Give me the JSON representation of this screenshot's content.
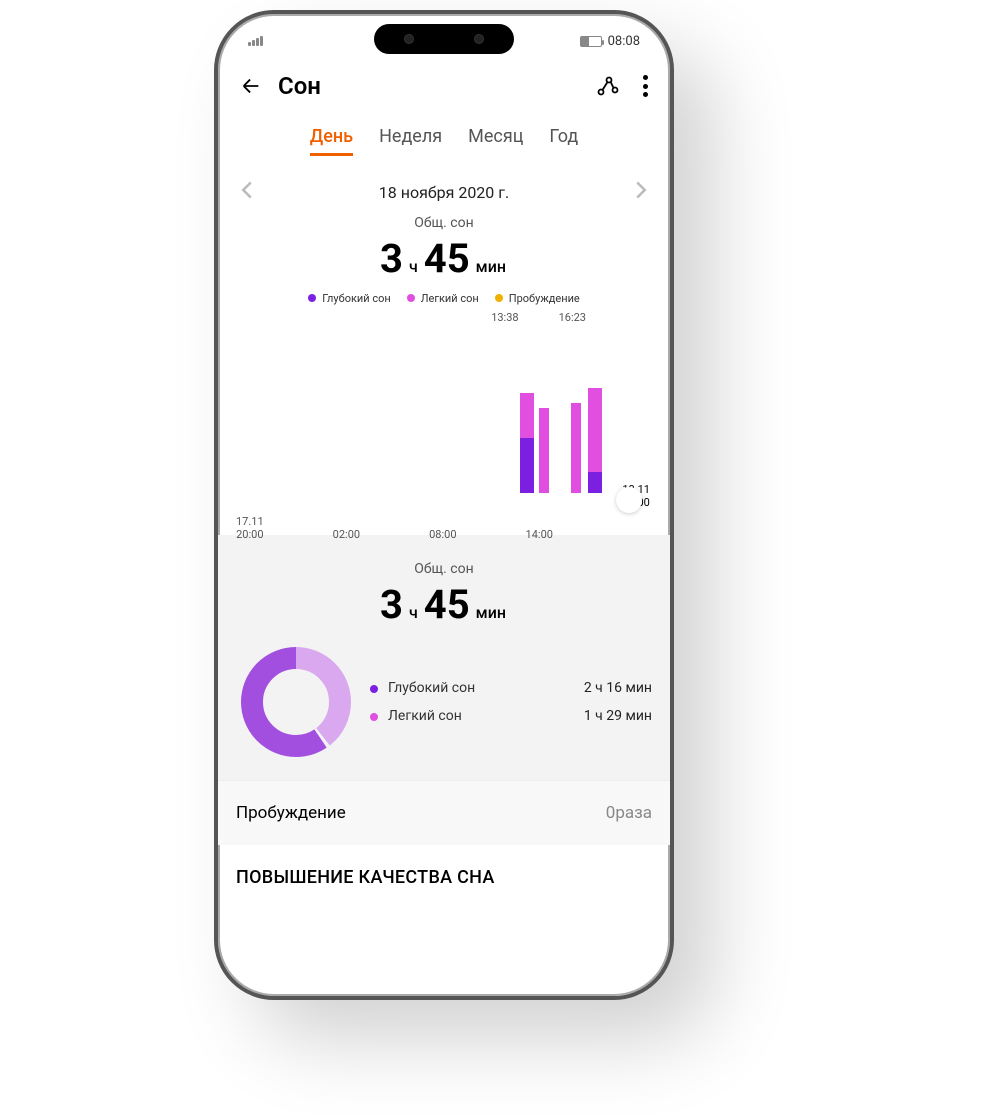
{
  "status": {
    "time": "08:08"
  },
  "nav": {
    "title": "Сон"
  },
  "tabs": [
    "День",
    "Неделя",
    "Месяц",
    "Год"
  ],
  "active_tab": 0,
  "date": "18 ноября 2020 г.",
  "total": {
    "label": "Общ. сон",
    "hours": "3",
    "hours_unit": "ч",
    "minutes": "45",
    "minutes_unit": "мин"
  },
  "legend": {
    "deep": "Глубокий сон",
    "light": "Легкий сон",
    "awake": "Пробуждение"
  },
  "time_marks": {
    "start": "13:38",
    "end": "16:23"
  },
  "right_date": {
    "date": "18.11",
    "time": "20:00"
  },
  "x_axis": [
    {
      "upper": "17.11",
      "lower": "20:00"
    },
    {
      "lower": "02:00"
    },
    {
      "lower": "08:00"
    },
    {
      "lower": "14:00"
    }
  ],
  "summary": {
    "label": "Общ. сон",
    "hours": "3",
    "hours_unit": "ч",
    "minutes": "45",
    "minutes_unit": "мин",
    "rows": [
      {
        "dot": "deep",
        "name": "Глубокий сон",
        "value": "2 ч 16 мин"
      },
      {
        "dot": "light",
        "name": "Легкий сон",
        "value": "1 ч 29 мин"
      }
    ]
  },
  "wake": {
    "name": "Пробуждение",
    "value": "0раза"
  },
  "section": "ПОВЫШЕНИЕ КАЧЕСТВА СНА",
  "colors": {
    "deep": "#7b1fe0",
    "light": "#e04fe0",
    "light2": "#d07be8",
    "awake": "#f0b000",
    "accent": "#f06000"
  },
  "chart_data": {
    "type": "bar",
    "title": "Сон 18 ноября 2020 г.",
    "x_range": [
      "17.11 20:00",
      "18.11 20:00"
    ],
    "series_legend": [
      "Глубокий сон",
      "Легкий сон",
      "Пробуждение"
    ],
    "segments": [
      {
        "start": "13:38",
        "end": "14:20",
        "stack": [
          {
            "type": "deep",
            "frac": 0.55
          },
          {
            "type": "light",
            "frac": 0.45
          }
        ]
      },
      {
        "start": "14:25",
        "end": "14:40",
        "stack": [
          {
            "type": "light",
            "frac": 1.0
          }
        ]
      },
      {
        "start": "15:20",
        "end": "15:40",
        "stack": [
          {
            "type": "light",
            "frac": 1.0
          }
        ]
      },
      {
        "start": "15:45",
        "end": "16:23",
        "stack": [
          {
            "type": "deep",
            "frac": 0.15
          },
          {
            "type": "light",
            "frac": 0.85
          }
        ]
      }
    ],
    "donut": {
      "deep_minutes": 136,
      "light_minutes": 89,
      "total_minutes": 225
    }
  }
}
